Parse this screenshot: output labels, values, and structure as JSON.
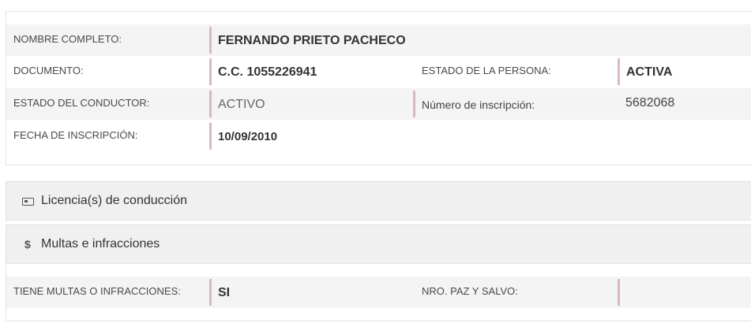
{
  "person": {
    "nombre_label": "NOMBRE COMPLETO:",
    "nombre_value": "FERNANDO PRIETO PACHECO",
    "documento_label": "DOCUMENTO:",
    "documento_value": "C.C. 1055226941",
    "estado_persona_label": "ESTADO DE LA PERSONA:",
    "estado_persona_value": "ACTIVA",
    "estado_conductor_label": "ESTADO DEL CONDUCTOR:",
    "estado_conductor_value": "ACTIVO",
    "numero_inscripcion_label": "Número de inscripción:",
    "numero_inscripcion_value": "5682068",
    "fecha_label": "FECHA DE INSCRIPCIÓN:",
    "fecha_value": "10/09/2010"
  },
  "panels": {
    "licencias": {
      "title": "Licencia(s) de conducción",
      "icon": "id-card-icon"
    },
    "multas": {
      "title": "Multas e infracciones",
      "icon": "dollar-icon",
      "icon_glyph": "$"
    }
  },
  "fines": {
    "tiene_label": "TIENE MULTAS O INFRACCIONES:",
    "tiene_value": "SI",
    "paz_label": "NRO. PAZ Y SALVO:",
    "paz_value": ""
  }
}
